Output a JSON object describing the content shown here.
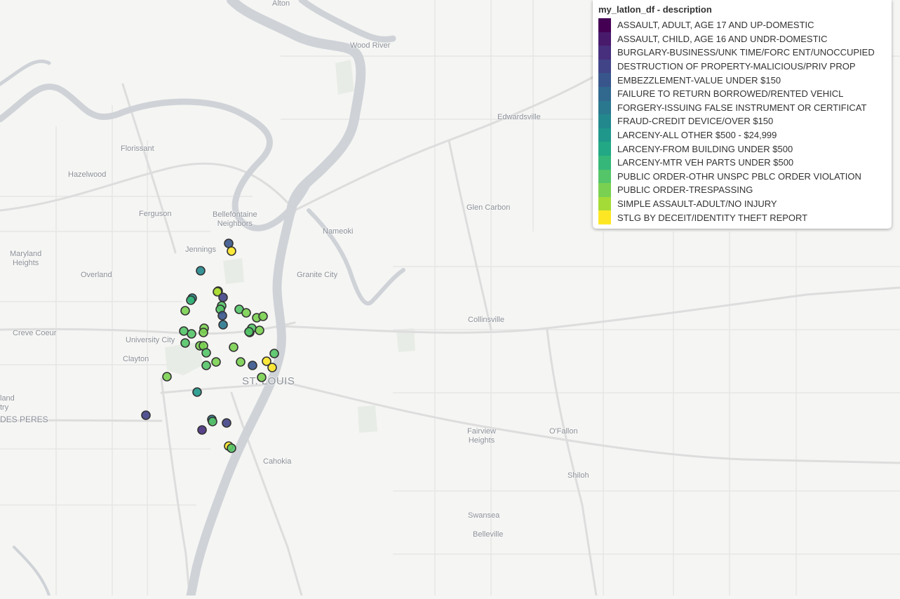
{
  "legend": {
    "title": "my_latlon_df - description",
    "entries": [
      {
        "label": "ASSAULT, ADULT, AGE 17 AND UP-DOMESTIC",
        "color": "#440154"
      },
      {
        "label": "ASSAULT, CHILD, AGE 16 AND UNDR-DOMESTIC",
        "color": "#481a6c"
      },
      {
        "label": "BURGLARY-BUSINESS/UNK TIME/FORC ENT/UNOCCUPIED",
        "color": "#472f7d"
      },
      {
        "label": "DESTRUCTION OF PROPERTY-MALICIOUS/PRIV PROP",
        "color": "#414487"
      },
      {
        "label": "EMBEZZLEMENT-VALUE UNDER $150",
        "color": "#39568c"
      },
      {
        "label": "FAILURE TO RETURN BORROWED/RENTED VEHICL",
        "color": "#31688e"
      },
      {
        "label": "FORGERY-ISSUING FALSE INSTRUMENT OR CERTIFICAT",
        "color": "#2a788e"
      },
      {
        "label": "FRAUD-CREDIT DEVICE/OVER $150",
        "color": "#23888e"
      },
      {
        "label": "LARCENY-ALL OTHER $500 - $24,999",
        "color": "#1f988b"
      },
      {
        "label": "LARCENY-FROM BUILDING UNDER $500",
        "color": "#22a884"
      },
      {
        "label": "LARCENY-MTR VEH PARTS UNDER $500",
        "color": "#35b779"
      },
      {
        "label": "PUBLIC ORDER-OTHR UNSPC PBLC ORDER VIOLATION",
        "color": "#54c568"
      },
      {
        "label": "PUBLIC ORDER-TRESPASSING",
        "color": "#7ad151"
      },
      {
        "label": "SIMPLE ASSAULT-ADULT/NO INJURY",
        "color": "#a5db36"
      },
      {
        "label": "STLG BY DECEIT/IDENTITY THEFT REPORT",
        "color": "#fde725"
      }
    ]
  },
  "places": {
    "alton": "Alton",
    "wood_river": "Wood River",
    "edwardsville": "Edwardsville",
    "florissant": "Florissant",
    "hazelwood": "Hazelwood",
    "ferguson": "Ferguson",
    "bellefontaine": "Bellefontaine\nNeighbors",
    "jennings": "Jennings",
    "nameoki": "Nameoki",
    "glen_carbon": "Glen Carbon",
    "maryland_heights": "Maryland\nHeights",
    "overland": "Overland",
    "granite_city": "Granite City",
    "collinsville": "Collinsville",
    "creve_coeur": "Creve Coeur",
    "university_city": "University City",
    "clayton": "Clayton",
    "st_louis": "ST. LOUIS",
    "land": "land",
    "try": "try",
    "des_peres": "DES PERES",
    "fairview_heights": "Fairview\nHeights",
    "ofallon": "O'Fallon",
    "cahokia": "Cahokia",
    "shiloh": "Shiloh",
    "swansea": "Swansea",
    "belleville": "Belleville"
  },
  "incidents": [
    {
      "category": "EMBEZZLEMENT-VALUE UNDER $150",
      "color": "#39568c"
    },
    {
      "category": "STLG BY DECEIT/IDENTITY THEFT REPORT",
      "color": "#fde725"
    },
    {
      "category": "FRAUD-CREDIT DEVICE/OVER $150",
      "color": "#23888e"
    },
    {
      "category": "STLG BY DECEIT/IDENTITY THEFT REPORT",
      "color": "#fde725"
    },
    {
      "category": "SIMPLE ASSAULT-ADULT/NO INJURY",
      "color": "#a5db36"
    },
    {
      "category": "DESTRUCTION OF PROPERTY-MALICIOUS/PRIV PROP",
      "color": "#414487"
    },
    {
      "category": "PUBLIC ORDER-OTHR UNSPC PBLC ORDER VIOLATION",
      "color": "#54c568"
    },
    {
      "category": "PUBLIC ORDER-OTHR UNSPC PBLC ORDER VIOLATION",
      "color": "#54c568"
    },
    {
      "category": "EMBEZZLEMENT-VALUE UNDER $150",
      "color": "#39568c"
    },
    {
      "category": "FORGERY-ISSUING FALSE INSTRUMENT OR CERTIFICAT",
      "color": "#2a788e"
    },
    {
      "category": "FRAUD-CREDIT DEVICE/OVER $150",
      "color": "#23888e"
    },
    {
      "category": "LARCENY-MTR VEH PARTS UNDER $500",
      "color": "#35b779"
    },
    {
      "category": "PUBLIC ORDER-TRESPASSING",
      "color": "#7ad151"
    },
    {
      "category": "PUBLIC ORDER-OTHR UNSPC PBLC ORDER VIOLATION",
      "color": "#54c568"
    },
    {
      "category": "PUBLIC ORDER-TRESPASSING",
      "color": "#7ad151"
    },
    {
      "category": "PUBLIC ORDER-TRESPASSING",
      "color": "#7ad151"
    },
    {
      "category": "PUBLIC ORDER-TRESPASSING",
      "color": "#7ad151"
    },
    {
      "category": "PUBLIC ORDER-OTHR UNSPC PBLC ORDER VIOLATION",
      "color": "#54c568"
    },
    {
      "category": "PUBLIC ORDER-OTHR UNSPC PBLC ORDER VIOLATION",
      "color": "#54c568"
    },
    {
      "category": "PUBLIC ORDER-TRESPASSING",
      "color": "#7ad151"
    },
    {
      "category": "PUBLIC ORDER-TRESPASSING",
      "color": "#7ad151"
    },
    {
      "category": "PUBLIC ORDER-OTHR UNSPC PBLC ORDER VIOLATION",
      "color": "#54c568"
    },
    {
      "category": "PUBLIC ORDER-TRESPASSING",
      "color": "#7ad151"
    },
    {
      "category": "PUBLIC ORDER-TRESPASSING",
      "color": "#7ad151"
    },
    {
      "category": "PUBLIC ORDER-OTHR UNSPC PBLC ORDER VIOLATION",
      "color": "#54c568"
    },
    {
      "category": "PUBLIC ORDER-TRESPASSING",
      "color": "#7ad151"
    },
    {
      "category": "PUBLIC ORDER-OTHR UNSPC PBLC ORDER VIOLATION",
      "color": "#54c568"
    },
    {
      "category": "PUBLIC ORDER-OTHR UNSPC PBLC ORDER VIOLATION",
      "color": "#54c568"
    },
    {
      "category": "PUBLIC ORDER-TRESPASSING",
      "color": "#7ad151"
    },
    {
      "category": "PUBLIC ORDER-OTHR UNSPC PBLC ORDER VIOLATION",
      "color": "#54c568"
    },
    {
      "category": "PUBLIC ORDER-TRESPASSING",
      "color": "#7ad151"
    },
    {
      "category": "PUBLIC ORDER-OTHR UNSPC PBLC ORDER VIOLATION",
      "color": "#54c568"
    },
    {
      "category": "PUBLIC ORDER-TRESPASSING",
      "color": "#7ad151"
    },
    {
      "category": "EMBEZZLEMENT-VALUE UNDER $150",
      "color": "#39568c"
    },
    {
      "category": "STLG BY DECEIT/IDENTITY THEFT REPORT",
      "color": "#fde725"
    },
    {
      "category": "PUBLIC ORDER-OTHR UNSPC PBLC ORDER VIOLATION",
      "color": "#54c568"
    },
    {
      "category": "STLG BY DECEIT/IDENTITY THEFT REPORT",
      "color": "#fde725"
    },
    {
      "category": "PUBLIC ORDER-TRESPASSING",
      "color": "#7ad151"
    },
    {
      "category": "PUBLIC ORDER-TRESPASSING",
      "color": "#7ad151"
    },
    {
      "category": "LARCENY-ALL OTHER $500 - $24,999",
      "color": "#1f988b"
    },
    {
      "category": "FORGERY-ISSUING FALSE INSTRUMENT OR CERTIFICAT",
      "color": "#2a788e"
    },
    {
      "category": "DESTRUCTION OF PROPERTY-MALICIOUS/PRIV PROP",
      "color": "#414487"
    },
    {
      "category": "PUBLIC ORDER-OTHR UNSPC PBLC ORDER VIOLATION",
      "color": "#54c568"
    },
    {
      "category": "BURGLARY-BUSINESS/UNK TIME/FORC ENT/UNOCCUPIED",
      "color": "#472f7d"
    },
    {
      "category": "DESTRUCTION OF PROPERTY-MALICIOUS/PRIV PROP",
      "color": "#414487"
    },
    {
      "category": "STLG BY DECEIT/IDENTITY THEFT REPORT",
      "color": "#fde725"
    },
    {
      "category": "PUBLIC ORDER-OTHR UNSPC PBLC ORDER VIOLATION",
      "color": "#54c568"
    }
  ]
}
